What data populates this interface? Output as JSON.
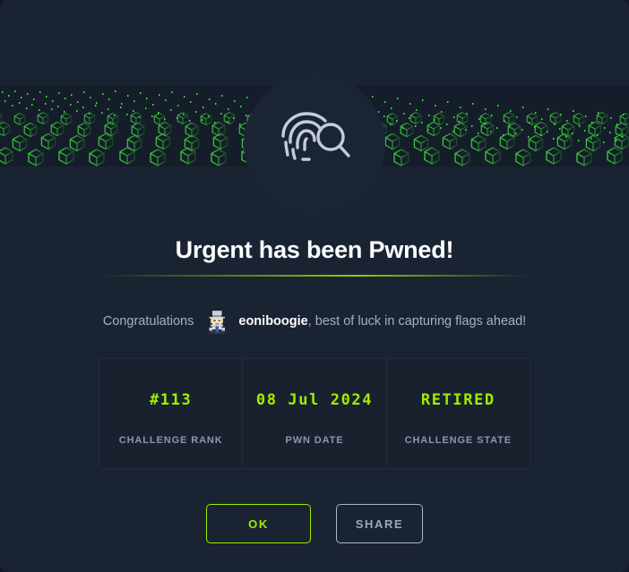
{
  "modal": {
    "background_color": "#1a2332",
    "accent_color": "#9fef00"
  },
  "banner": {
    "name": "cube-wave-banner",
    "description": "isometric green cube grid with particle wave",
    "cube_color": "#2e9b2e",
    "particle_color": "#3bff3b"
  },
  "icon": {
    "name": "fingerprint-search-icon",
    "color": "#c3ccdb",
    "circle_color": "#1b2434"
  },
  "heading": {
    "title": "Urgent has been Pwned!"
  },
  "congrats": {
    "prefix": "Congratulations",
    "username": "eoniboogie",
    "suffix": ", best of luck in capturing flags ahead!",
    "avatar_name": "user-avatar"
  },
  "stats": [
    {
      "value": "#113",
      "label": "CHALLENGE RANK"
    },
    {
      "value": "08 Jul 2024",
      "label": "PWN DATE"
    },
    {
      "value": "RETIRED",
      "label": "CHALLENGE STATE"
    }
  ],
  "buttons": {
    "ok_label": "OK",
    "share_label": "SHARE"
  }
}
